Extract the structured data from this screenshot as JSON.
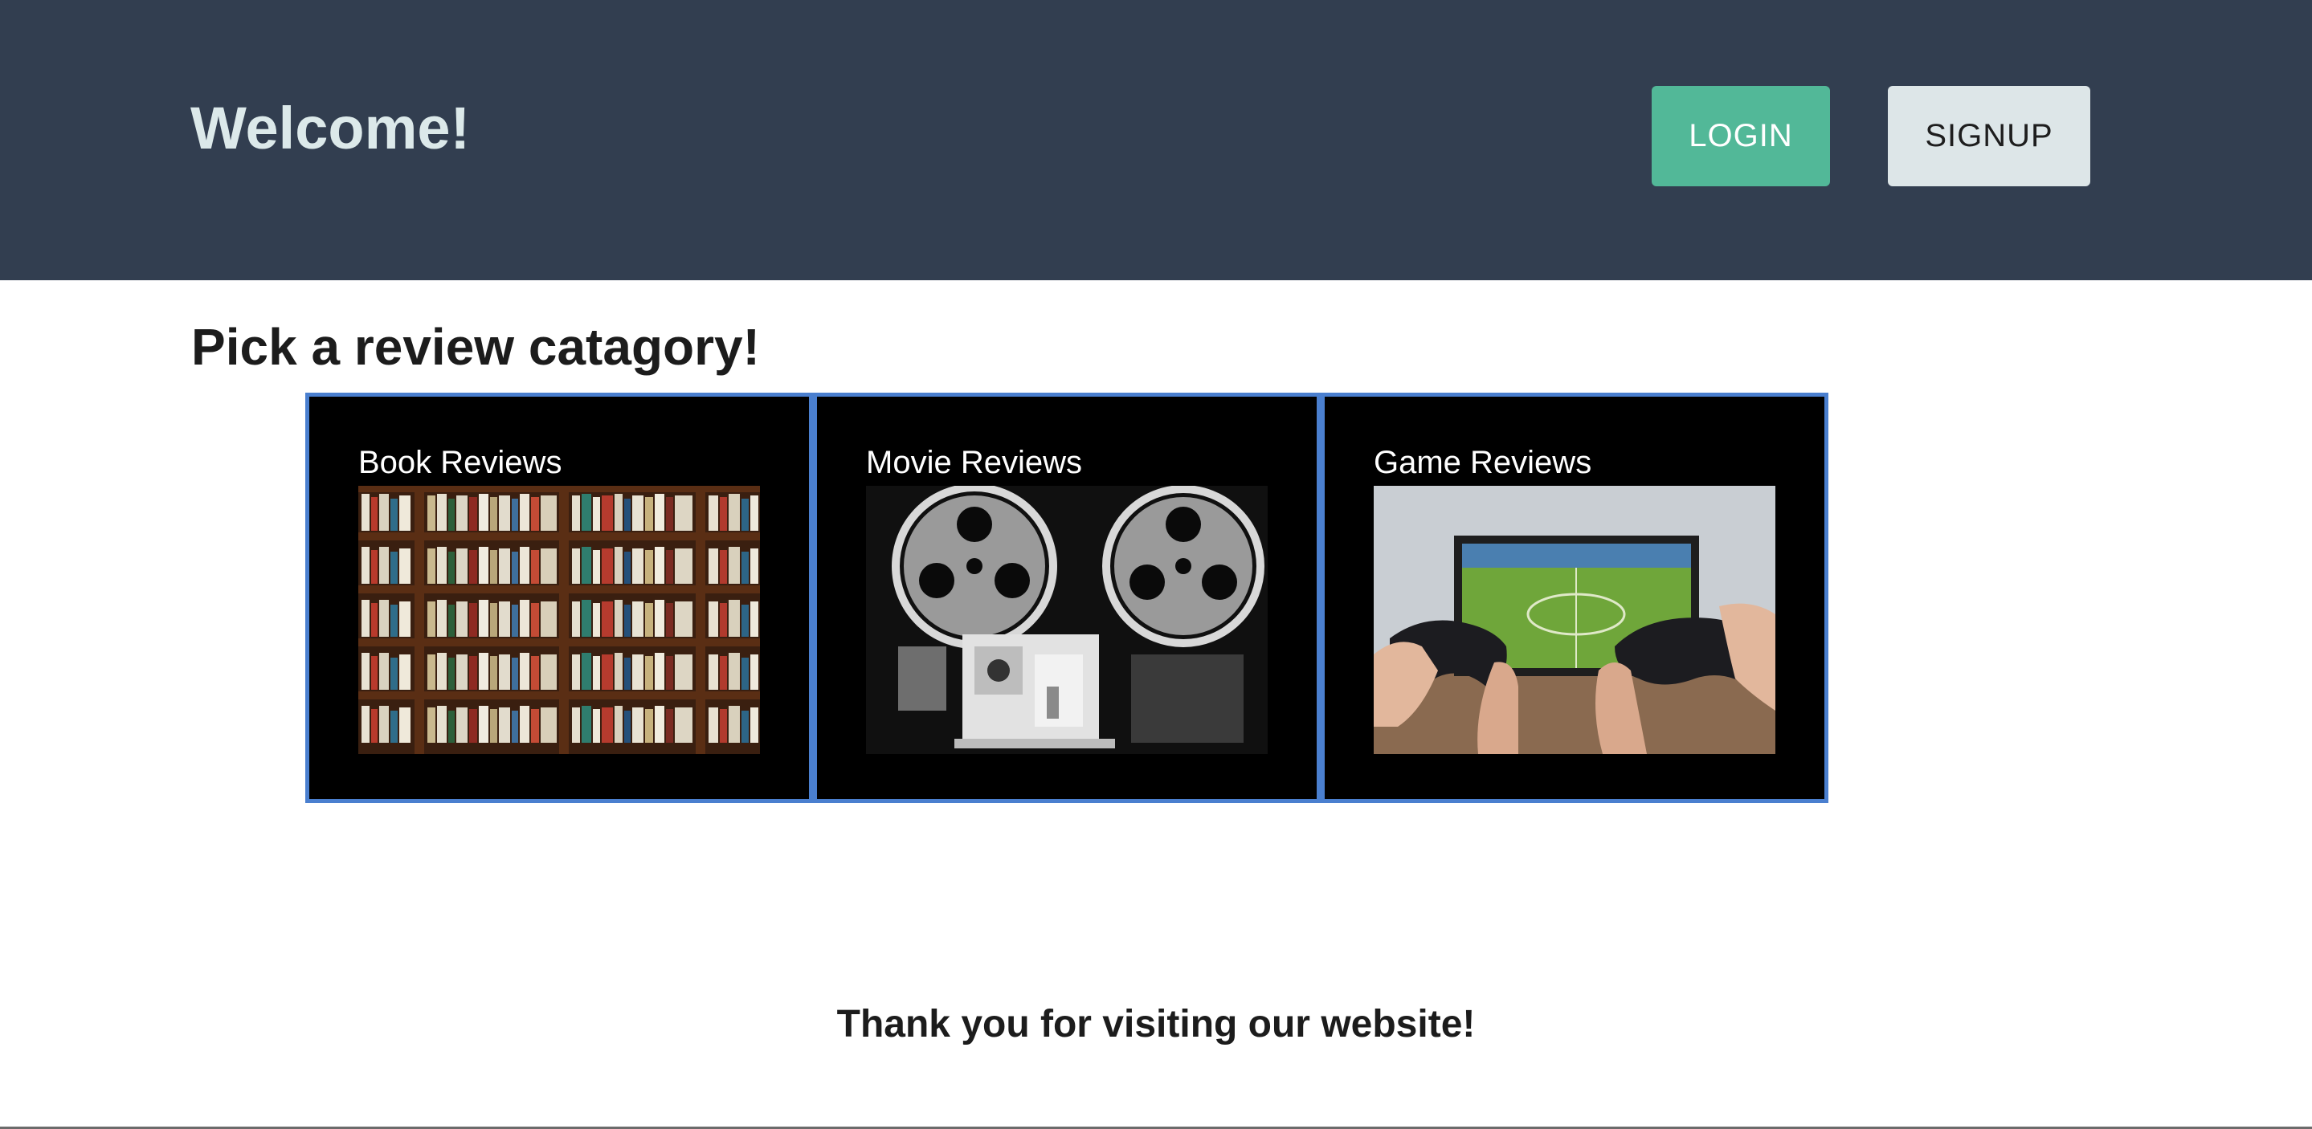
{
  "header": {
    "title": "Welcome!",
    "login_label": "LOGIN",
    "signup_label": "SIGNUP"
  },
  "main": {
    "heading": "Pick a review catagory!",
    "categories": [
      {
        "label": "Book Reviews",
        "image": "bookshelf-photo"
      },
      {
        "label": "Movie Reviews",
        "image": "film-projector-photo"
      },
      {
        "label": "Game Reviews",
        "image": "game-controllers-photo"
      }
    ]
  },
  "footer": {
    "message": "Thank you for visiting our website!"
  },
  "colors": {
    "header_bg": "#323e50",
    "login_bg": "#52b898",
    "signup_bg": "#dde6e8",
    "card_border": "#4a7fcf",
    "card_bg": "#000000"
  }
}
